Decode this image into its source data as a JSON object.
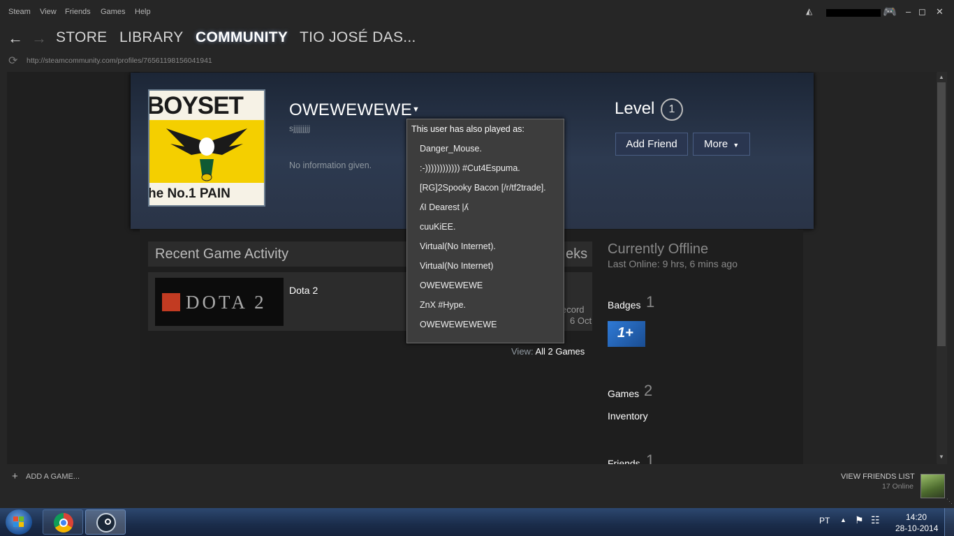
{
  "menubar": {
    "items": [
      "Steam",
      "View",
      "Friends",
      "Games",
      "Help"
    ]
  },
  "nav": {
    "links": [
      "STORE",
      "LIBRARY",
      "COMMUNITY",
      "TIO JOSÉ DAS..."
    ]
  },
  "url": "http://steamcommunity.com/profiles/76561198156041941",
  "profile": {
    "avatar_text_top": "BOYSET",
    "avatar_text_bottom": "he No.1 PAIN",
    "name": "OWEWEWEWE",
    "real_name": "sjjjjjjjjj",
    "summary": "No information given.",
    "level_label": "Level",
    "level_value": "1",
    "add_friend": "Add Friend",
    "more": "More"
  },
  "popup": {
    "title": "This user has also played as:",
    "aliases": [
      "Danger_Mouse.",
      ":-)))))))))))) #Cut4Espuma.",
      "[RG]2Spooky Bacon [/r/tf2trade].",
      "ʎI Dearest |ʎ",
      "cuuKiEE.",
      "Virtual(No Internet).",
      "Virtual(No Internet)",
      "OWEWEWEWE",
      "ZnX #Hype.",
      "OWEWEWEWEWE"
    ]
  },
  "activity": {
    "title": "Recent Game Activity",
    "hours_partial": "eks",
    "game_name": "Dota 2",
    "game_logo_text": "DOTA 2",
    "record_partial": "ecord",
    "date_partial": "6 Oct",
    "view_label": "View:",
    "view_link": "All 2 Games"
  },
  "sidebar": {
    "status": "Currently Offline",
    "last_online": "Last Online: 9 hrs, 6 mins ago",
    "badges_label": "Badges",
    "badges_count": "1",
    "badge_icon_text": "1+",
    "games_label": "Games",
    "games_count": "2",
    "inventory": "Inventory",
    "friends_label": "Friends",
    "friends_count": "1"
  },
  "bottom": {
    "add_game": "ADD A GAME...",
    "view_friends": "VIEW FRIENDS LIST",
    "online_count": "17 Online"
  },
  "taskbar": {
    "lang": "PT",
    "time": "14:20",
    "date": "28-10-2014"
  },
  "colors": {
    "accent_blue": "#2a3650",
    "link_white": "#ffffff",
    "taskbar_blue": "#1a2c4a"
  }
}
